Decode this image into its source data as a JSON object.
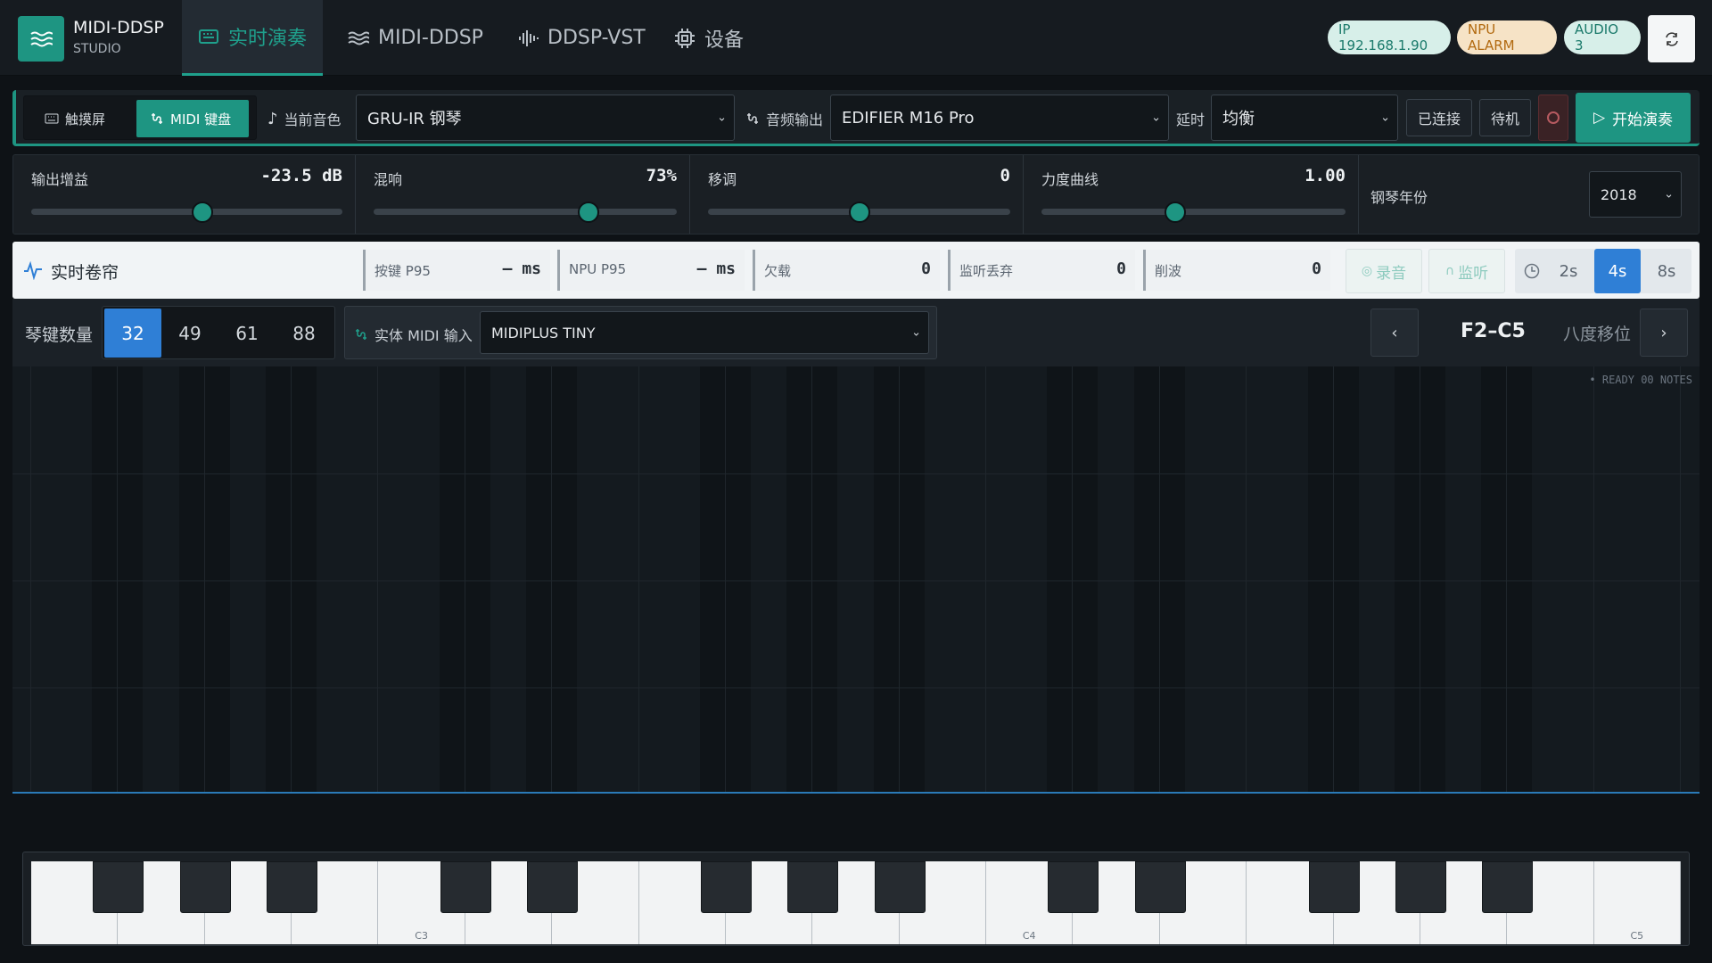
{
  "brand": {
    "title": "MIDI-DDSP",
    "subtitle": "STUDIO"
  },
  "nav": {
    "tabs": [
      {
        "label": "实时演奏",
        "icon": "keyboard-icon",
        "active": true
      },
      {
        "label": "MIDI-DDSP",
        "icon": "waves-icon",
        "active": false
      },
      {
        "label": "DDSP-VST",
        "icon": "audio-bars-icon",
        "active": false
      },
      {
        "label": "设备",
        "icon": "chip-icon",
        "active": false
      }
    ]
  },
  "status": {
    "ip": "IP 192.168.1.90",
    "npu": "NPU ALARM",
    "audio": "AUDIO 3"
  },
  "colors": {
    "accent": "#1e9582",
    "blue": "#2f7fd6",
    "npu_pill": "#f6e3c6",
    "ok_pill": "#d7efe9"
  },
  "toolbar": {
    "input_modes": [
      "触摸屏",
      "MIDI 键盘"
    ],
    "tone_label": "当前音色",
    "tone_value": "GRU-IR 钢琴",
    "output_label": "音频输出",
    "output_value": "EDIFIER M16 Pro",
    "latency_label": "延时",
    "latency_value": "均衡",
    "connected": "已连接",
    "standby": "待机",
    "start": "开始演奏"
  },
  "sliders": [
    {
      "name": "输出增益",
      "value": "-23.5 dB",
      "level": 0.55
    },
    {
      "name": "混响",
      "value": "73%",
      "level": 0.71
    },
    {
      "name": "移调",
      "value": "0",
      "level": 0.5
    },
    {
      "name": "力度曲线",
      "value": "1.00",
      "level": 0.44
    }
  ],
  "piano_year": {
    "label": "钢琴年份",
    "value": "2018"
  },
  "roll": {
    "title": "实时卷帘",
    "metrics": [
      {
        "name": "按键 P95",
        "value": "— ms"
      },
      {
        "name": "NPU P95",
        "value": "— ms"
      },
      {
        "name": "欠载",
        "value": "0"
      },
      {
        "name": "监听丢弃",
        "value": "0"
      },
      {
        "name": "削波",
        "value": "0"
      }
    ],
    "record": "录音",
    "monitor": "监听",
    "windows": [
      "2s",
      "4s",
      "8s"
    ],
    "active_window": "4s",
    "status": "• READY 00 NOTES"
  },
  "keys": {
    "label": "琴键数量",
    "options": [
      "32",
      "49",
      "61",
      "88"
    ],
    "selected": "32",
    "midi_label": "实体 MIDI 输入",
    "midi_value": "MIDIPLUS TINY",
    "range": "F2–C5",
    "octave_label": "八度移位"
  },
  "keyboard": {
    "labels": [
      "C3",
      "C4",
      "C5"
    ]
  }
}
